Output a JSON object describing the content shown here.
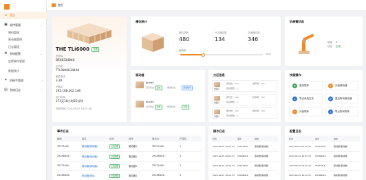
{
  "sidebar": {
    "items": [
      {
        "label": "首页",
        "active": true,
        "icon": "home-icon"
      },
      {
        "label": "叔传管理",
        "icon": "device-icon",
        "has_children": true
      },
      {
        "label": "物料管理",
        "sub": true
      },
      {
        "label": "驱动器管理",
        "sub": true
      },
      {
        "label": "日志管理",
        "sub": true
      },
      {
        "label": "系统配置",
        "icon": "settings-icon",
        "has_children": true
      },
      {
        "label": "告警事件管理",
        "sub": true
      },
      {
        "label": "数据统计",
        "sub": true
      },
      {
        "label": "机械手管理",
        "icon": "robot-icon",
        "has_children": true
      },
      {
        "label": "系统日志",
        "icon": "log-icon",
        "has_children": true
      }
    ]
  },
  "topbar": {
    "title": "首页"
  },
  "device": {
    "name": "THE TLi6000",
    "status": "正常",
    "fields": [
      {
        "label": "系统ID",
        "value": "DE68334848"
      },
      {
        "label": "主机名",
        "value": "TTL0866634448"
      },
      {
        "label": "固件版本",
        "value": "3.20"
      },
      {
        "label": "IP地址",
        "value": "192.168.202.148"
      },
      {
        "label": "运行时间",
        "value": "273天18小时35分钟"
      }
    ],
    "footer": "同步时间 2023-09-07 18:07:38"
  },
  "magazine": {
    "title": "槽位统计",
    "stats": [
      {
        "label": "槽位总数",
        "value": "480"
      },
      {
        "label": "已占槽位数",
        "value": "134"
      },
      {
        "label": "空闲槽位数",
        "value": "346"
      }
    ],
    "progress_label": "使用率",
    "progress_value": "28%",
    "progress_fraction": 0.28
  },
  "robot": {
    "title": "机械臂状态",
    "fields": [
      {
        "label": "数量",
        "value": "1"
      },
      {
        "label": "状态",
        "value": "正常"
      }
    ]
  },
  "drives": {
    "title": "驱动器",
    "items": [
      {
        "name": "drive4",
        "labels": [
          "运行状态",
          "正常",
          "使用状态",
          "卸载磁带"
        ]
      },
      {
        "name": "drive4",
        "labels": [
          "运行状态",
          "正常",
          "使用状态",
          "空闲"
        ]
      }
    ]
  },
  "partitions": {
    "title": "分区信息",
    "items": [
      {
        "name": "分区1",
        "slot_total": "槽位数：100",
        "used": "磁带槽：100",
        "drive_count": "驱动器数：2"
      },
      {
        "name": "分区2",
        "slot_total": "槽位数：100",
        "used": "磁带槽：100",
        "drive_count": "驱动器数：2"
      },
      {
        "name": "分区3",
        "slot_total": "槽位数：100",
        "used": "磁带槽：100",
        "drive_count": "驱动器数：2"
      }
    ]
  },
  "quick": {
    "title": "快捷操作",
    "items": [
      {
        "label": "重启带库",
        "color": "#3aa757",
        "icon": "restart-icon"
      },
      {
        "label": "升级驱动器",
        "color": "#f08a24",
        "icon": "upgrade-icon"
      },
      {
        "label": "导出系统日志",
        "color": "#2f6fd6",
        "icon": "export-icon"
      },
      {
        "label": "重启所有驱动器",
        "color": "#2f6fd6",
        "icon": "drives-restart-icon"
      },
      {
        "label": "升级带库",
        "color": "#f08a24",
        "icon": "library-upgrade-icon"
      },
      {
        "label": "导出所有带库",
        "color": "#2f6fd6",
        "icon": "export-all-icon"
      }
    ]
  },
  "events": {
    "title": "事件日志",
    "columns": [
      "编码",
      "事件",
      "状态",
      "操作",
      "驱动ID",
      "严重性"
    ],
    "rows": [
      [
        "TEST16L8",
        "驱动器(驱动器)",
        "已处理",
        "驱动器1",
        "TEST16L8",
        "1"
      ],
      [
        "2918M6L6",
        "驱动器(驱动器)",
        "已处理",
        "驱动器1",
        "2918M6L6",
        "3"
      ],
      [
        "TEST16L8",
        "驱动器(驱动器)",
        "已处理",
        "驱动器1",
        "TEST16L8",
        "1"
      ],
      [
        "2918M6L6",
        "驱动器(驱动...",
        "已处理",
        "驱动器1",
        "2918M6L6",
        "3"
      ]
    ]
  },
  "ops": {
    "title": "操作日志",
    "columns": [
      "时间",
      "事件",
      "描述"
    ],
    "rows": [
      [
        "2023-09-07 16:22:33",
        "TEST16L8",
        "驱动器(驱动器)"
      ],
      [
        "2023-09-07 16:22:33",
        "2918M6L6",
        "驱动器(驱动器)"
      ],
      [
        "2023-09-07 16:22:33",
        "TEST16L8",
        "驱动器(驱动器)"
      ],
      [
        "2023-09-07 16:22:33",
        "2918M6L6",
        "驱动器(驱动器)"
      ]
    ]
  },
  "config": {
    "title": "配置日志",
    "columns": [
      "时间",
      "事件",
      "描述"
    ],
    "rows": [
      [
        "2023-09-07 16:22:33",
        "TEST16L8",
        "驱动器(驱动器)"
      ],
      [
        "2023-09-07 16:22:33",
        "2918M6L6",
        "驱动器(驱动器)"
      ],
      [
        "2023-09-07 16:22:33",
        "TEST16L8",
        "驱动器(驱动器)"
      ],
      [
        "2023-09-07 16:22:33",
        "2918M6L6",
        "驱动器(驱动器)"
      ]
    ]
  },
  "colors": {
    "accent": "#f08a24",
    "ok": "#2e9a4a",
    "link": "#1a6fd6"
  }
}
